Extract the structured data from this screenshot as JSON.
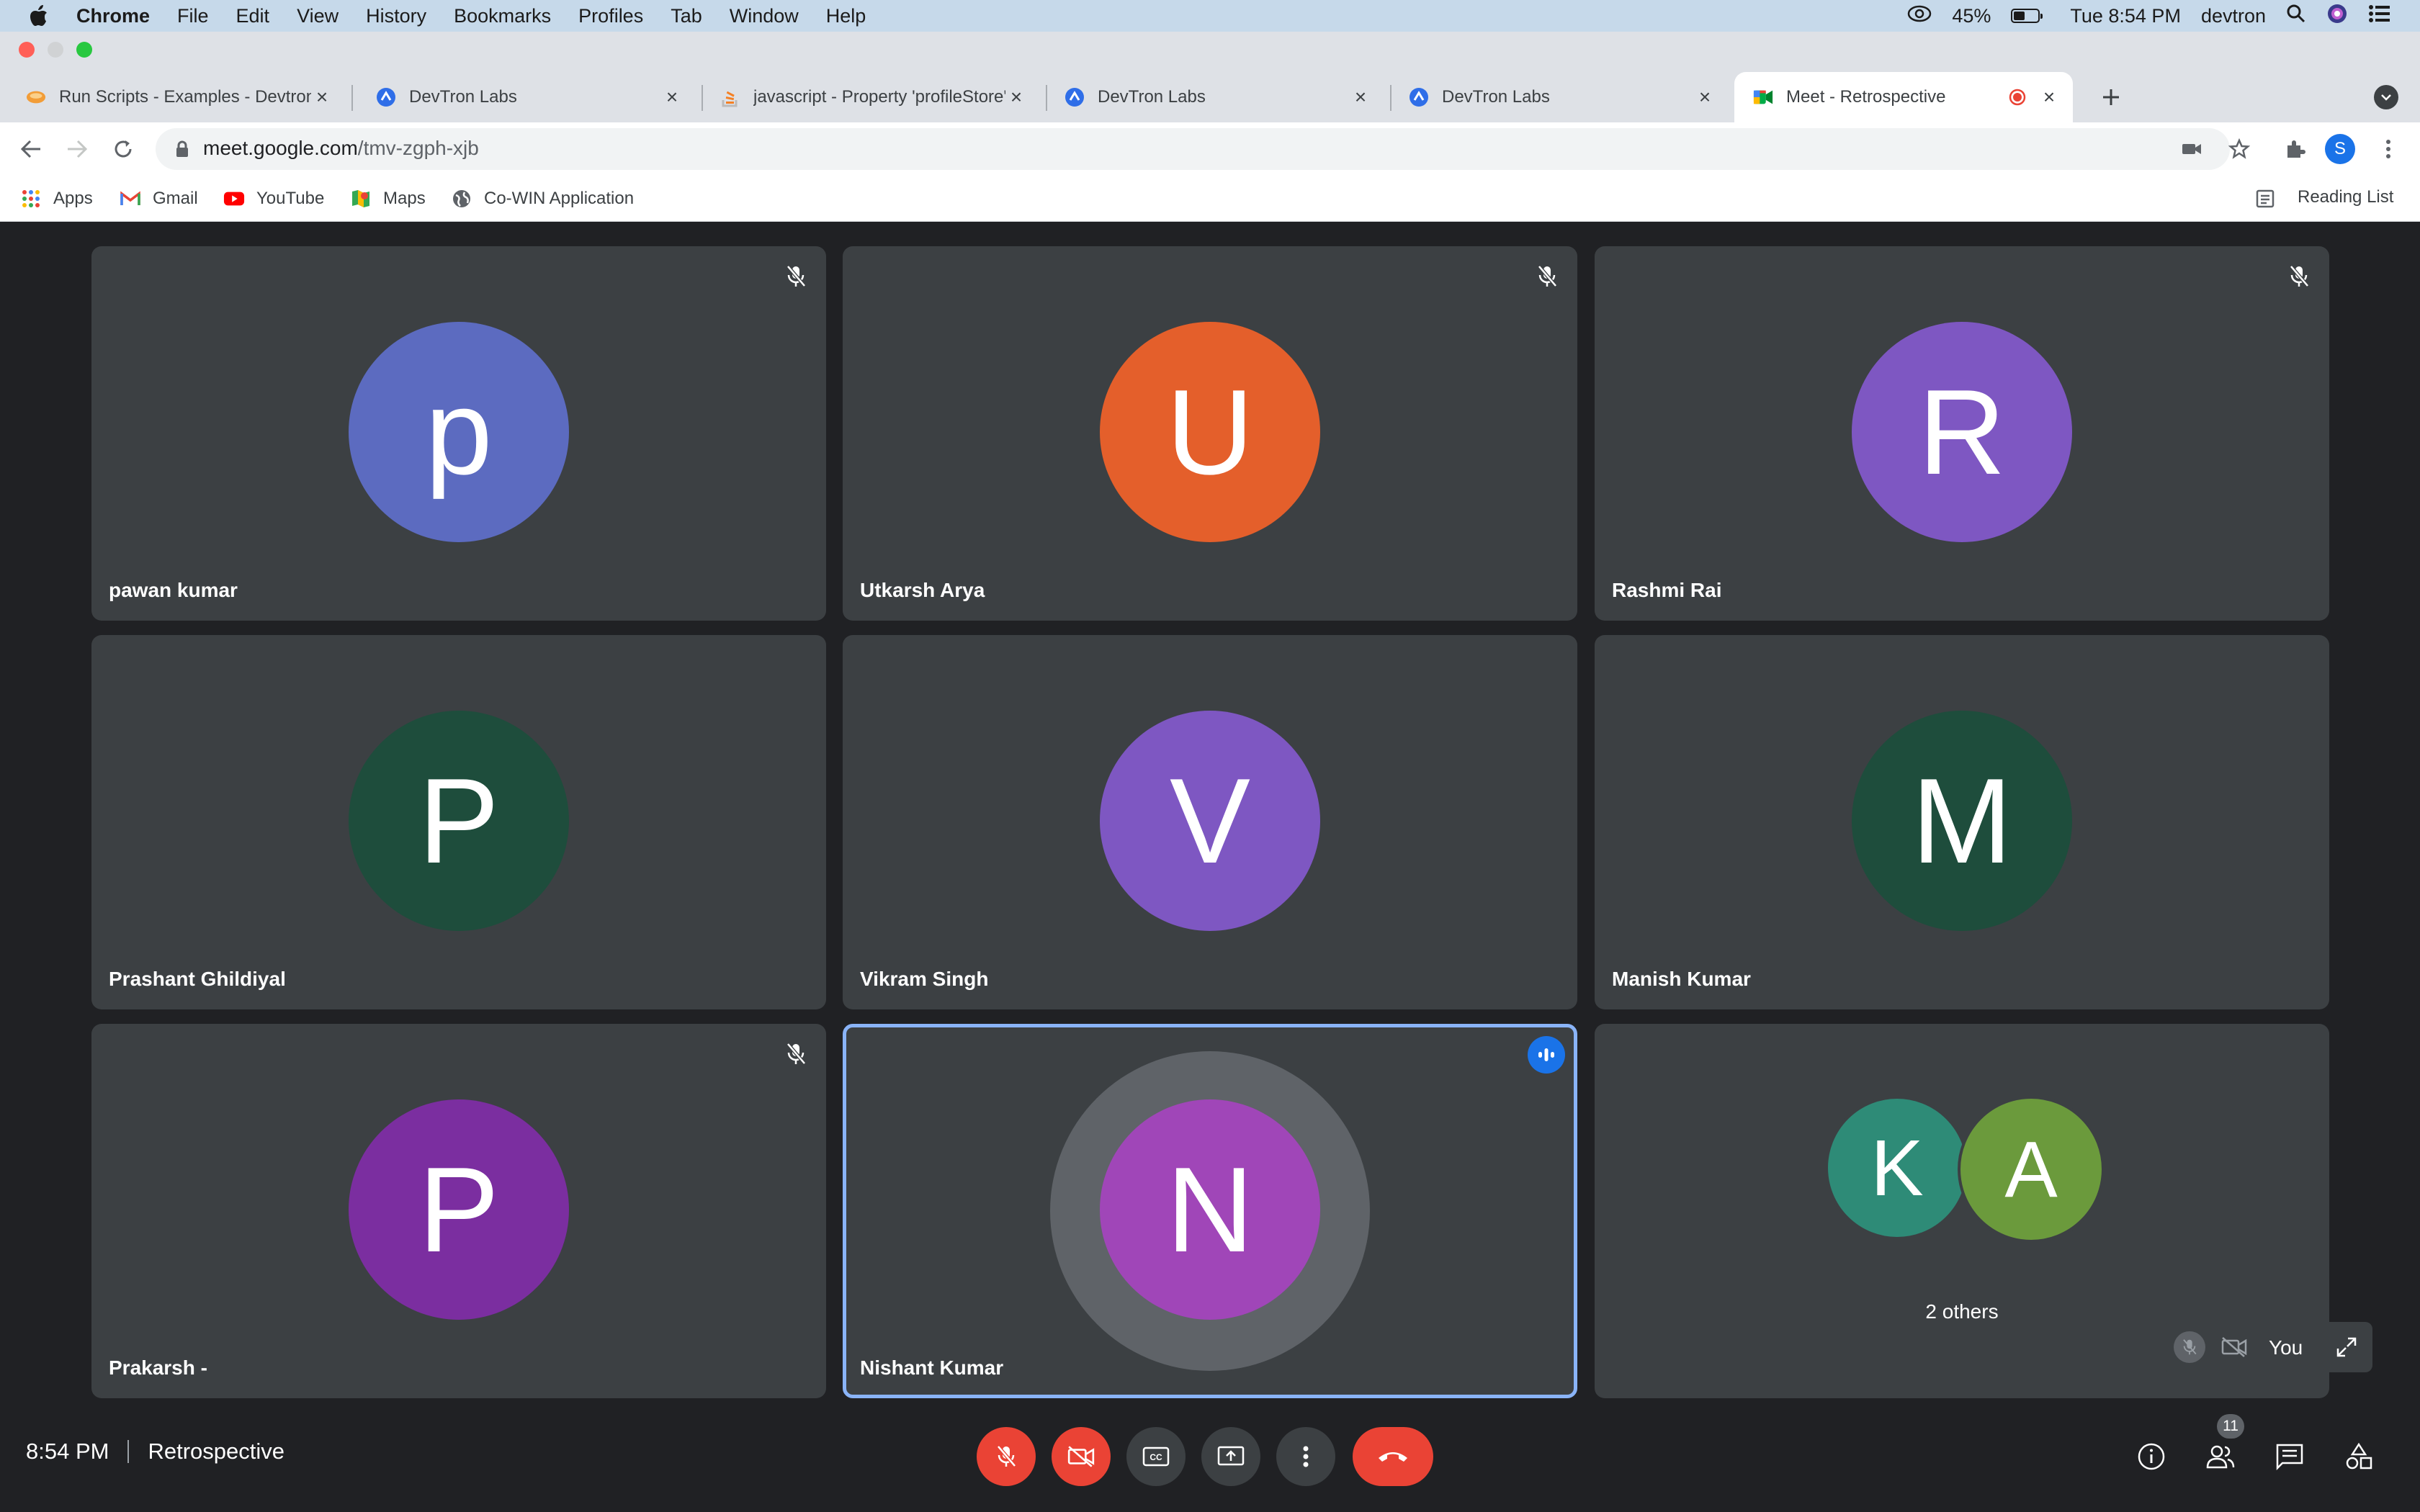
{
  "menubar": {
    "app": "Chrome",
    "items": [
      "File",
      "Edit",
      "View",
      "History",
      "Bookmarks",
      "Profiles",
      "Tab",
      "Window",
      "Help"
    ],
    "battery": "45%",
    "battery_level": 0.45,
    "clock": "Tue 8:54 PM",
    "user": "devtron"
  },
  "tabs": [
    {
      "title": "Run Scripts - Examples - Devtron",
      "icon": "notebook-icon",
      "active": false
    },
    {
      "title": "DevTron Labs",
      "icon": "devtron-icon",
      "active": false
    },
    {
      "title": "javascript - Property 'profileStore'",
      "icon": "stackoverflow-icon",
      "active": false
    },
    {
      "title": "DevTron Labs",
      "icon": "devtron-icon",
      "active": false
    },
    {
      "title": "DevTron Labs",
      "icon": "devtron-icon",
      "active": false
    },
    {
      "title": "Meet - Retrospective",
      "icon": "meet-icon",
      "active": true,
      "recording": true
    }
  ],
  "address": {
    "host": "meet.google.com",
    "path": "/tmv-zgph-xjb"
  },
  "bookmarks": [
    {
      "label": "Apps",
      "icon": "apps-grid-icon"
    },
    {
      "label": "Gmail",
      "icon": "gmail-icon"
    },
    {
      "label": "YouTube",
      "icon": "youtube-icon"
    },
    {
      "label": "Maps",
      "icon": "maps-icon"
    },
    {
      "label": "Co-WIN Application",
      "icon": "globe-icon"
    }
  ],
  "reading_list": "Reading List",
  "profile_initial": "S",
  "participants": [
    {
      "name": "pawan kumar",
      "initial": "p",
      "color": "#5c6bc0",
      "muted": true
    },
    {
      "name": "Utkarsh Arya",
      "initial": "U",
      "color": "#e45f2b",
      "muted": true
    },
    {
      "name": "Rashmi Rai",
      "initial": "R",
      "color": "#7e57c2",
      "muted": true
    },
    {
      "name": "Prashant Ghildiyal",
      "initial": "P",
      "color": "#1e4d3c",
      "muted": false
    },
    {
      "name": "Vikram Singh",
      "initial": "V",
      "color": "#7e57c2",
      "muted": false
    },
    {
      "name": "Manish Kumar",
      "initial": "M",
      "color": "#1e4d3c",
      "muted": false
    },
    {
      "name": "Prakarsh -",
      "initial": "P",
      "color": "#7b2ea0",
      "muted": true
    },
    {
      "name": "Nishant Kumar",
      "initial": "N",
      "color": "#a046b8",
      "muted": false,
      "speaking": true
    }
  ],
  "others": {
    "label": "2 others",
    "avatars": [
      {
        "initial": "K",
        "color": "#2e8b77"
      },
      {
        "initial": "A",
        "color": "#6b9a3c"
      }
    ]
  },
  "self_view": {
    "label": "You"
  },
  "bottom_bar": {
    "time": "8:54 PM",
    "meeting_name": "Retrospective",
    "people_count": "11"
  },
  "colors": {
    "meet_bg": "#202124",
    "tile_bg": "#3c4043",
    "control_red": "#ea4335",
    "speaking_border": "#8ab4f8"
  }
}
